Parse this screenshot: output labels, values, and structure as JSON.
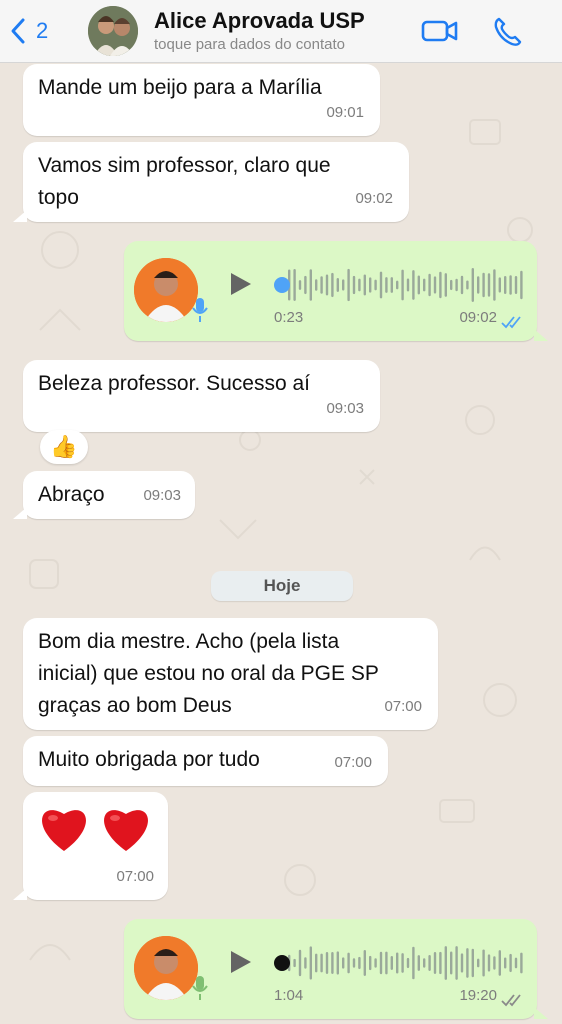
{
  "header": {
    "back_count": "2",
    "contact_name": "Alice Aprovada USP",
    "subtitle": "toque para dados do contato",
    "icons": [
      "back-chevron-icon",
      "video-call-icon",
      "phone-call-icon"
    ]
  },
  "messages": [
    {
      "dir": "in",
      "text": "Mande um beijo para a Marília",
      "time": "09:01"
    },
    {
      "dir": "in",
      "text_line1": "Vamos sim professor, claro que",
      "text_line2": "topo",
      "time": "09:02"
    },
    {
      "dir": "out",
      "type": "voice",
      "duration": "0:23",
      "time": "09:02",
      "status": "read",
      "progress": 0
    },
    {
      "dir": "in",
      "text": "Beleza professor. Sucesso aí",
      "time": "09:03",
      "reaction": "👍"
    },
    {
      "dir": "in",
      "text": "Abraço",
      "time": "09:03"
    },
    {
      "dir": "in",
      "text_line1": "Bom dia mestre. Acho (pela lista",
      "text_line2": "inicial) que estou no oral da PGE SP",
      "text_line3": "graças ao bom Deus",
      "time": "07:00"
    },
    {
      "dir": "in",
      "text": "Muito obrigada por tudo",
      "time": "07:00"
    },
    {
      "dir": "in",
      "type": "emoji",
      "emoji": "❤️❤️",
      "time": "07:00"
    },
    {
      "dir": "out",
      "type": "voice",
      "duration": "1:04",
      "time": "19:20",
      "status": "delivered",
      "progress": 0
    }
  ],
  "day_separator": "Hoje",
  "colors": {
    "incoming": "#ffffff",
    "outgoing": "#dcf8c6",
    "accent": "#1f7cf2",
    "read_ticks": "#4fa3f7",
    "background": "#ece5dd"
  }
}
